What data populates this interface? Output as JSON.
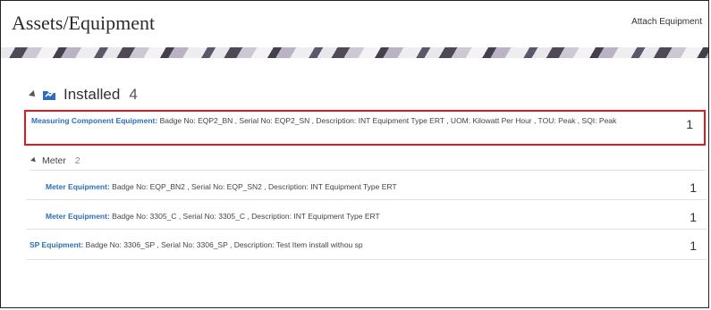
{
  "header": {
    "title": "Assets/Equipment",
    "attach_label": "Attach Equipment"
  },
  "installed": {
    "label": "Installed",
    "count": "4"
  },
  "items": [
    {
      "type_label": "Measuring Component Equipment:",
      "details": "Badge No: EQP2_BN , Serial No: EQP2_SN , Description: INT Equipment Type ERT , UOM: Kilowatt Per Hour , TOU: Peak , SQI: Peak",
      "count": "1"
    },
    {
      "type_label": "Meter Equipment:",
      "details": "Badge No: EQP_BN2 , Serial No: EQP_SN2 , Description: INT Equipment Type ERT",
      "count": "1"
    },
    {
      "type_label": "Meter Equipment:",
      "details": "Badge No: 3305_C , Serial No: 3305_C , Description: INT Equipment Type ERT",
      "count": "1"
    },
    {
      "type_label": "SP Equipment:",
      "details": "Badge No: 3306_SP , Serial No: 3306_SP , Description: Test Item install withou sp",
      "count": "1"
    }
  ],
  "meter_group": {
    "label": "Meter",
    "count": "2"
  },
  "colors": {
    "link": "#2f6fb6",
    "highlight_border": "#e0191f",
    "icon": "#2f6fb6"
  },
  "icons": {
    "installed": "equipment-folder-icon",
    "expand": "expand-triangle-icon"
  }
}
